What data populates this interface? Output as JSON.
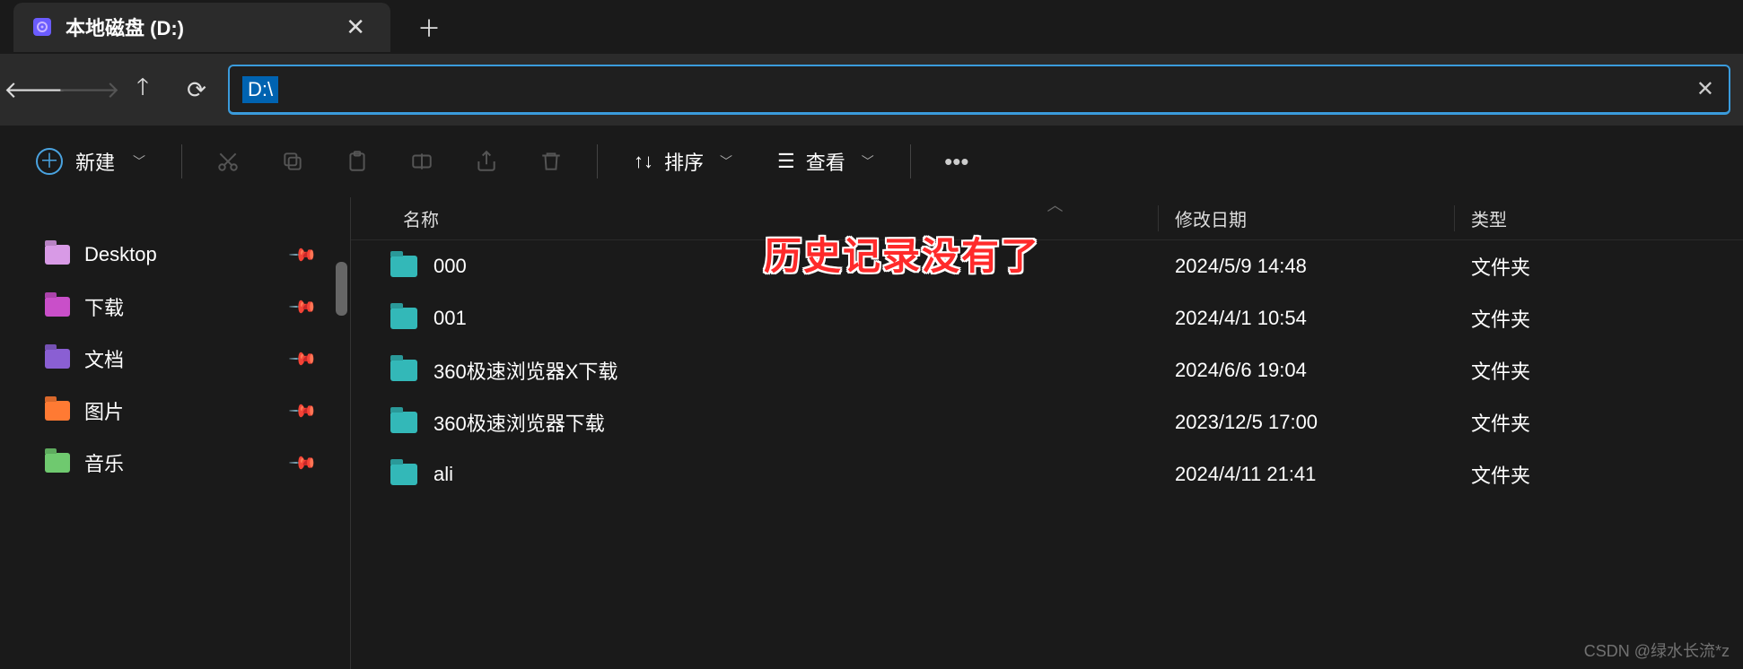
{
  "tab": {
    "title": "本地磁盘 (D:)"
  },
  "addr": {
    "path": "D:\\"
  },
  "toolbar": {
    "new": "新建",
    "sort": "排序",
    "view": "查看"
  },
  "sidebar": {
    "items": [
      {
        "label": "Desktop",
        "color": "#d89ae6"
      },
      {
        "label": "下载",
        "color": "#c94fc9"
      },
      {
        "label": "文档",
        "color": "#8a5fd3"
      },
      {
        "label": "图片",
        "color": "#ff7a33"
      },
      {
        "label": "音乐",
        "color": "#6fc96f"
      }
    ]
  },
  "filelist": {
    "headers": {
      "name": "名称",
      "date": "修改日期",
      "type": "类型"
    },
    "rows": [
      {
        "name": "000",
        "date": "2024/5/9 14:48",
        "type": "文件夹"
      },
      {
        "name": "001",
        "date": "2024/4/1 10:54",
        "type": "文件夹"
      },
      {
        "name": "360极速浏览器X下载",
        "date": "2024/6/6 19:04",
        "type": "文件夹"
      },
      {
        "name": "360极速浏览器下载",
        "date": "2023/12/5 17:00",
        "type": "文件夹"
      },
      {
        "name": "ali",
        "date": "2024/4/11 21:41",
        "type": "文件夹"
      }
    ]
  },
  "annotation": "历史记录没有了",
  "watermark": "CSDN @绿水长流*z"
}
